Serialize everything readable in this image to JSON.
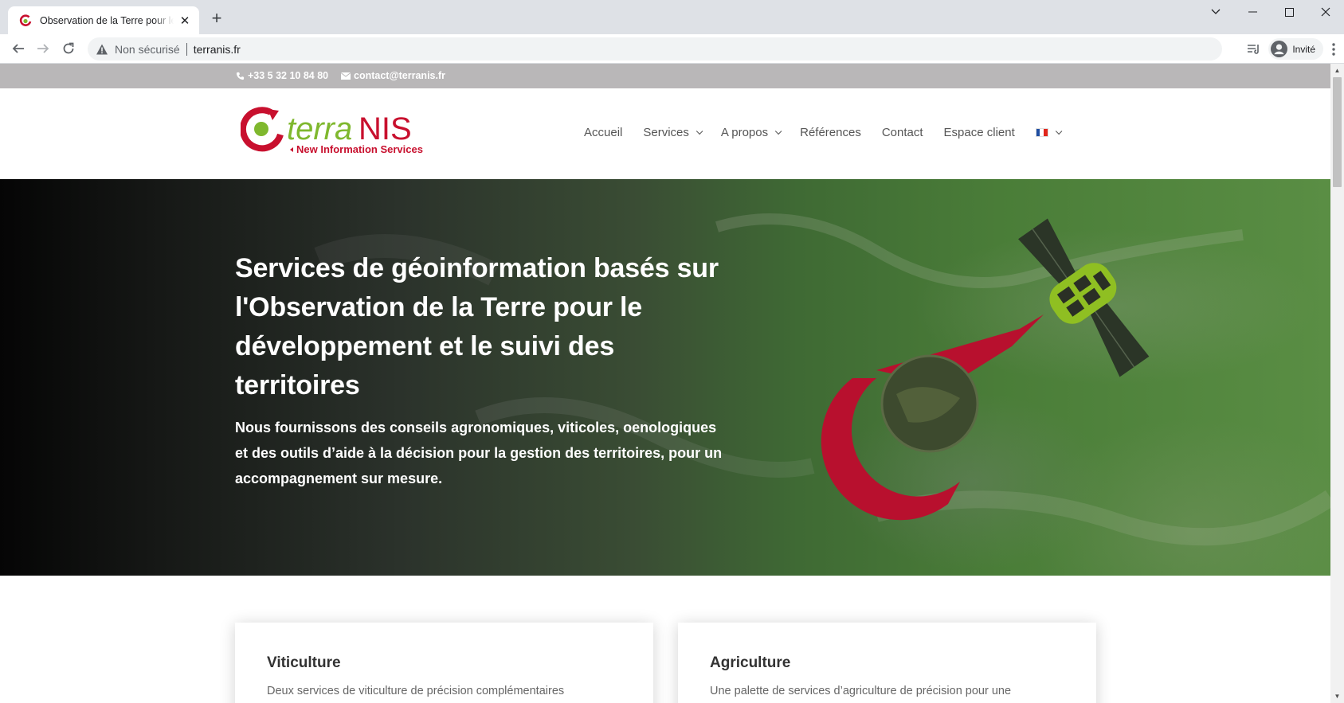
{
  "browser": {
    "tab_title": "Observation de la Terre pour le développement et le suivi des territoires",
    "new_tab_symbol": "+",
    "insecure_label": "Non sécurisé",
    "url": "terranis.fr",
    "profile_label": "Invité"
  },
  "topbar": {
    "phone": "+33 5 32 10 84 80",
    "email": "contact@terranis.fr",
    "background": "#b9b7b8"
  },
  "logo": {
    "name": "terraNIS",
    "tagline": "New Information Services",
    "red": "#c8102e",
    "green": "#7fb82e"
  },
  "nav": {
    "items": [
      {
        "label": "Accueil"
      },
      {
        "label": "Services"
      },
      {
        "label": "A propos"
      },
      {
        "label": "Références"
      },
      {
        "label": "Contact"
      },
      {
        "label": "Espace client"
      }
    ],
    "language_flag": "fr-flag-icon"
  },
  "hero": {
    "title": "Services de géoinformation basés sur l'Observation de la Terre pour le développement et le suivi des territoires",
    "subtitle": "Nous fournissons des conseils agronomiques, viticoles, oenologiques et des outils d’aide à la décision pour la gestion des territoires, pour un accompagnement sur mesure."
  },
  "cards": [
    {
      "title": "Viticulture",
      "text": "Deux services de viticulture de précision complémentaires"
    },
    {
      "title": "Agriculture",
      "text": "Une palette de services d’agriculture de précision pour une"
    }
  ]
}
